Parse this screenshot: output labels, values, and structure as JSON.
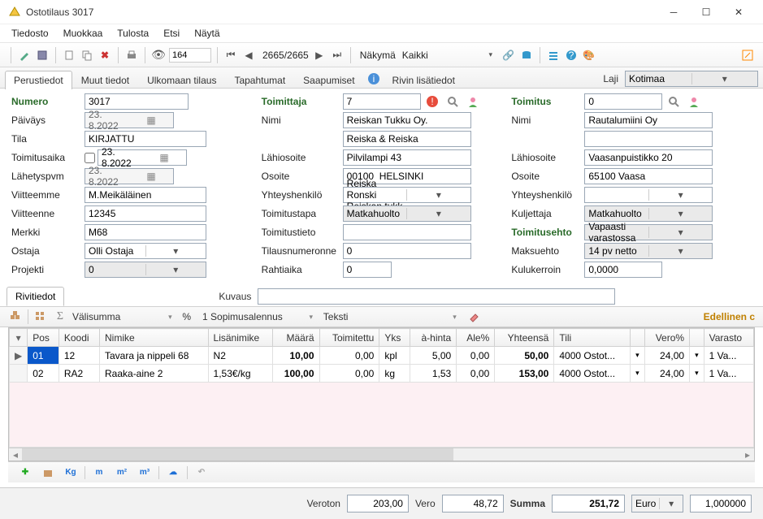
{
  "window": {
    "title": "Ostotilaus 3017"
  },
  "menu": [
    "Tiedosto",
    "Muokkaa",
    "Tulosta",
    "Etsi",
    "Näytä"
  ],
  "toolbar": {
    "record_input": "164",
    "nav_pos": "2665/2665",
    "view_label": "Näkymä",
    "view_value": "Kaikki"
  },
  "tabs": [
    "Perustiedot",
    "Muut tiedot",
    "Ulkomaan tilaus",
    "Tapahtumat",
    "Saapumiset",
    "Rivin lisätiedot"
  ],
  "laji": {
    "label": "Laji",
    "value": "Kotimaa"
  },
  "left": {
    "numero_lbl": "Numero",
    "numero": "3017",
    "paivays_lbl": "Päiväys",
    "paivays": "23. 8.2022",
    "tila_lbl": "Tila",
    "tila": "KIRJATTU",
    "toimitusaika_lbl": "Toimitusaika",
    "toimitusaika": "23. 8.2022",
    "lahetyspvm_lbl": "Lähetyspvm",
    "lahetyspvm": "23. 8.2022",
    "viitteemme_lbl": "Viitteemme",
    "viitteemme": "M.Meikäläinen",
    "viitteenne_lbl": "Viitteenne",
    "viitteenne": "12345",
    "merkki_lbl": "Merkki",
    "merkki": "M68",
    "ostaja_lbl": "Ostaja",
    "ostaja": "Olli Ostaja",
    "projekti_lbl": "Projekti",
    "projekti": "0"
  },
  "mid": {
    "toimittaja_lbl": "Toimittaja",
    "toimittaja": "7",
    "nimi_lbl": "Nimi",
    "nimi1": "Reiskan Tukku Oy.",
    "nimi2": "Reiska & Reiska",
    "lahiosoite_lbl": "Lähiosoite",
    "lahiosoite": "Pilvilampi 43",
    "osoite_lbl": "Osoite",
    "osoite": "00100  HELSINKI",
    "yhteyshenkilo_lbl": "Yhteyshenkilö",
    "yhteyshenkilo": "Reiska Ronski Reiskan tukk",
    "toimitustapa_lbl": "Toimitustapa",
    "toimitustapa": "Matkahuolto",
    "toimitustieto_lbl": "Toimitustieto",
    "toimitustieto": "",
    "tilausnumeronne_lbl": "Tilausnumeronne",
    "tilausnumeronne": "0",
    "rahtiaika_lbl": "Rahtiaika",
    "rahtiaika": "0"
  },
  "right": {
    "toimitus_lbl": "Toimitus",
    "toimitus": "0",
    "nimi_lbl": "Nimi",
    "nimi": "Rautalumiini Oy",
    "blank1": "",
    "lahiosoite_lbl": "Lähiosoite",
    "lahiosoite": "Vaasanpuistikko 20",
    "osoite_lbl": "Osoite",
    "osoite": "65100 Vaasa",
    "yhteyshenkilo_lbl": "Yhteyshenkilö",
    "yhteyshenkilo": "",
    "kuljettaja_lbl": "Kuljettaja",
    "kuljettaja": "Matkahuolto",
    "toimitusehto_lbl": "Toimitusehto",
    "toimitusehto": "Vapaasti varastossa",
    "maksuehto_lbl": "Maksuehto",
    "maksuehto": "14 pv netto",
    "kulukerroin_lbl": "Kulukerroin",
    "kulukerroin": "0,0000"
  },
  "rivitiedot": {
    "tab": "Rivitiedot",
    "kuvaus_lbl": "Kuvaus",
    "kuvaus": "",
    "valisumma": "Välisumma",
    "pct": "%",
    "alennus": "1 Sopimusalennus",
    "teksti": "Teksti",
    "edellinen": "Edellinen c"
  },
  "grid": {
    "headers": [
      "",
      "Pos",
      "Koodi",
      "Nimike",
      "Lisänimike",
      "Määrä",
      "Toimitettu",
      "Yks",
      "à-hinta",
      "Ale%",
      "Yhteensä",
      "Tili",
      "",
      "Vero%",
      "",
      "Varasto"
    ],
    "rows": [
      {
        "rh": "▶",
        "pos": "01",
        "koodi": "12",
        "nimike": "Tavara ja nippeli 68",
        "lisa": "N2",
        "maara": "10,00",
        "toim": "0,00",
        "yks": "kpl",
        "ahinta": "5,00",
        "ale": "0,00",
        "yht": "50,00",
        "tili": "4000 Ostot...",
        "vero": "24,00",
        "var": "1 Va..."
      },
      {
        "rh": "",
        "pos": "02",
        "koodi": "RA2",
        "nimike": "Raaka-aine 2",
        "lisa": "1,53€/kg",
        "maara": "100,00",
        "toim": "0,00",
        "yks": "kg",
        "ahinta": "1,53",
        "ale": "0,00",
        "yht": "153,00",
        "tili": "4000 Ostot...",
        "vero": "24,00",
        "var": "1 Va..."
      }
    ]
  },
  "footbtns": [
    "Kg",
    "m",
    "m²",
    "m³"
  ],
  "totals": {
    "veroton_lbl": "Veroton",
    "veroton": "203,00",
    "vero_lbl": "Vero",
    "vero": "48,72",
    "summa_lbl": "Summa",
    "summa": "251,72",
    "valuutta": "Euro",
    "kurssi": "1,000000"
  }
}
